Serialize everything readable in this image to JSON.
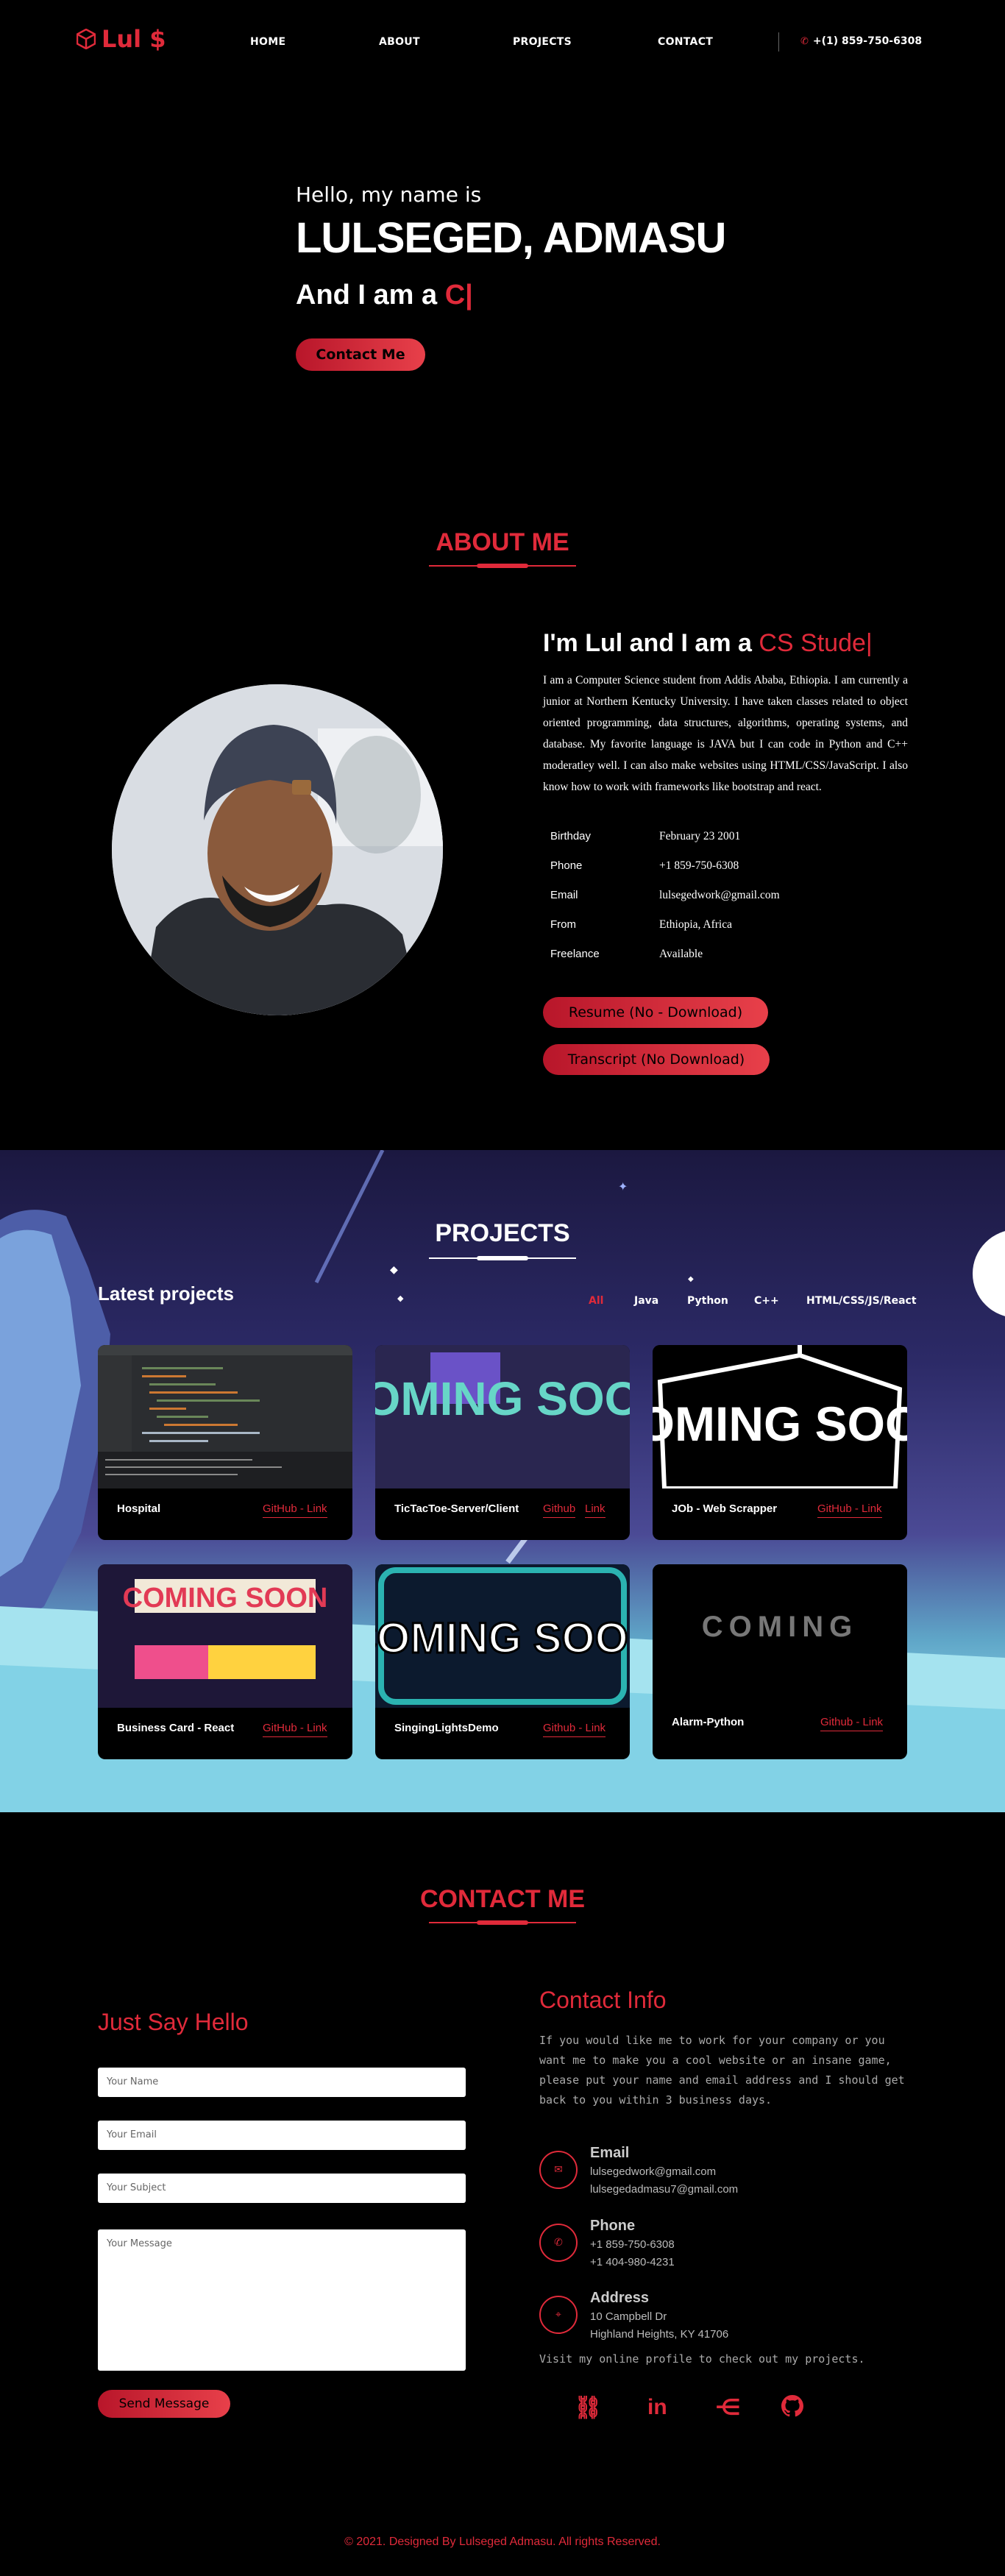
{
  "nav": {
    "logo": "Lul $",
    "links": [
      "HOME",
      "ABOUT",
      "PROJECTS",
      "CONTACT"
    ],
    "phone": "+(1) 859-750-6308"
  },
  "hero": {
    "greeting": "Hello, my name is",
    "name": "LULSEGED, ADMASU",
    "role_prefix": "And I am a",
    "role_typed": "C|",
    "contact_button": "Contact Me"
  },
  "about": {
    "section_title": "ABOUT ME",
    "heading_prefix": "I'm Lul and I am a",
    "heading_typed": "CS Stude|",
    "bio": "I am a Computer Science student from Addis Ababa, Ethiopia. I am currently a junior at Northern Kentucky University. I have taken classes related to object oriented programming, data structures, algorithms, operating systems, and database. My favorite language is JAVA but I can code in Python and C++ moderatley well. I can also make websites using HTML/CSS/JavaScript. I also know how to work with frameworks like bootstrap and react.",
    "info": [
      {
        "key": "Birthday",
        "value": "February 23 2001"
      },
      {
        "key": "Phone",
        "value": "+1 859-750-6308"
      },
      {
        "key": "Email",
        "value": "lulsegedwork@gmail.com"
      },
      {
        "key": "From",
        "value": "Ethiopia, Africa"
      },
      {
        "key": "Freelance",
        "value": "Available"
      }
    ],
    "resume_button": "Resume (No - Download)",
    "transcript_button": "Transcript (No Download)"
  },
  "projects": {
    "section_title": "PROJECTS",
    "latest": "Latest projects",
    "filters": [
      "All",
      "Java",
      "Python",
      "C++",
      "HTML/CSS/JS/React"
    ],
    "active_filter": "All",
    "cards": [
      {
        "title": "Hospital",
        "links": [
          "GitHub - Link"
        ],
        "image": "code-editor-screenshot"
      },
      {
        "title": "TicTacToe-Server/Client",
        "links": [
          "Github",
          "Link"
        ],
        "image": "coming-soon-colorful",
        "image_text": "COMING SOON"
      },
      {
        "title": "JOb - Web Scrapper",
        "links": [
          "GitHub - Link"
        ],
        "image": "coming-soon-sign",
        "image_text": "COMING SOON"
      },
      {
        "title": "Business Card - React",
        "links": [
          "GitHub - Link"
        ],
        "image": "coming-soon-tiles",
        "image_text": "COMING SOON"
      },
      {
        "title": "SingingLightsDemo",
        "links": [
          "Github - Link"
        ],
        "image": "coming-soon-bold",
        "image_text": "COMING SOON"
      },
      {
        "title": "Alarm-Python",
        "links": [
          "Github - Link"
        ],
        "image": "coming-blurred",
        "image_text": "COMING"
      }
    ]
  },
  "contact": {
    "section_title": "CONTACT ME",
    "say_hello": "Just Say Hello",
    "placeholders": {
      "name": "Your Name",
      "email": "Your Email",
      "subject": "Your Subject",
      "message": "Your Message"
    },
    "send_button": "Send Message",
    "info_title": "Contact Info",
    "info_text": "If you would like me to work for your company or you want me to make you a cool website or an insane game, please put your name and email address and I should get back to you within 3 business days.",
    "email_label": "Email",
    "emails": [
      "lulsegedwork@gmail.com",
      "lulsegedadmasu7@gmail.com"
    ],
    "phone_label": "Phone",
    "phones": [
      "+1 859-750-6308",
      "+1 404-980-4231"
    ],
    "address_label": "Address",
    "address": [
      "10 Campbell Dr",
      "Highland Heights, KY 41706"
    ],
    "visit_text": "Visit my online profile to check out my projects.",
    "social_icons": [
      "link-icon",
      "linkedin-icon",
      "handshake-icon",
      "github-icon"
    ]
  },
  "footer": {
    "text": "2021. Designed By Lulseged Admasu. All rights Reserved."
  },
  "colors": {
    "accent": "#e02a3a",
    "background": "#000000"
  }
}
